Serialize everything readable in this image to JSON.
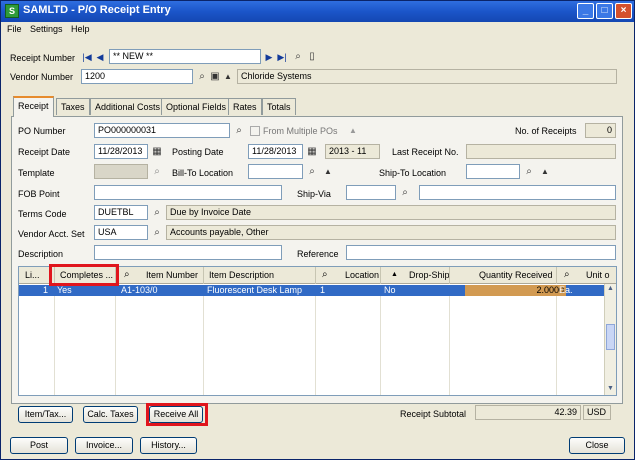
{
  "window": {
    "app_icon": "S",
    "title": "SAMLTD - P/O Receipt Entry",
    "buttons": [
      "minimize-icon",
      "maximize-icon",
      "close-icon"
    ]
  },
  "menu": [
    "File",
    "Settings",
    "Help"
  ],
  "header": {
    "receipt_number_label": "Receipt Number",
    "receipt_number_value": "** NEW **",
    "vendor_number_label": "Vendor Number",
    "vendor_number_value": "1200",
    "vendor_name": "Chloride Systems"
  },
  "tabs": [
    "Receipt",
    "Taxes",
    "Additional Costs",
    "Optional Fields",
    "Rates",
    "Totals"
  ],
  "form": {
    "po_number_label": "PO Number",
    "po_number_value": "PO000000031",
    "from_multiple_pos_label": "From Multiple POs",
    "no_of_receipts_label": "No. of Receipts",
    "no_of_receipts_value": "0",
    "receipt_date_label": "Receipt Date",
    "receipt_date_value": "11/28/2013",
    "posting_date_label": "Posting Date",
    "posting_date_value": "11/28/2013",
    "fiscal_period_value": "2013 - 11",
    "last_receipt_label": "Last Receipt No.",
    "template_label": "Template",
    "bill_to_label": "Bill-To Location",
    "ship_to_label": "Ship-To Location",
    "fob_label": "FOB Point",
    "ship_via_label": "Ship-Via",
    "terms_label": "Terms Code",
    "terms_value": "DUETBL",
    "terms_desc": "Due by Invoice Date",
    "vendor_acct_label": "Vendor Acct. Set",
    "vendor_acct_value": "USA",
    "vendor_acct_desc": "Accounts payable, Other",
    "description_label": "Description",
    "reference_label": "Reference"
  },
  "grid": {
    "columns": [
      "Li...",
      "Completes ...",
      "Item Number",
      "Item Description",
      "Location",
      "Drop-Ship",
      "Quantity Received",
      "Unit o"
    ],
    "rows": [
      {
        "line": "1",
        "completes": "Yes",
        "item_number": "A1-103/0",
        "description": "Fluorescent Desk Lamp",
        "location": "1",
        "drop_ship": "No",
        "quantity": "2.0000",
        "unit": "Ea."
      }
    ]
  },
  "actions": {
    "item_tax": "Item/Tax...",
    "calc_taxes": "Calc. Taxes",
    "receive_all": "Receive All"
  },
  "subtotal": {
    "label": "Receipt Subtotal",
    "value": "42.39",
    "currency": "USD"
  },
  "footer": {
    "post": "Post",
    "invoice": "Invoice...",
    "history": "History...",
    "close": "Close"
  },
  "highlight_color": "#e0151d",
  "accent_color": "#316ac5"
}
